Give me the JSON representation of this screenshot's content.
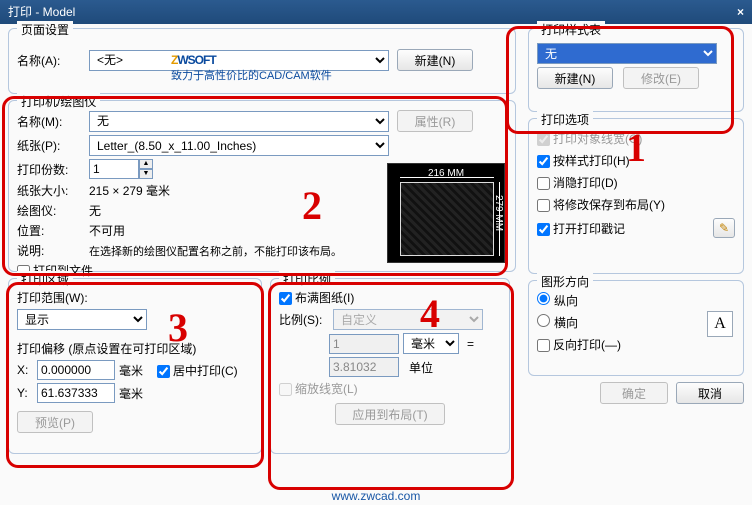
{
  "title": "打印 - Model",
  "page_setup": {
    "legend": "页面设置",
    "name_label": "名称(A):",
    "name_value": "<无>",
    "new_btn": "新建(N)"
  },
  "logo": {
    "tagline": "致力于高性价比的CAD/CAM软件"
  },
  "printer": {
    "legend": "打印机/绘图仪",
    "name_label": "名称(M):",
    "name_value": "无",
    "props_btn": "属性(R)",
    "paper_label": "纸张(P):",
    "paper_value": "Letter_(8.50_x_11.00_Inches)",
    "copies_label": "打印份数:",
    "copies_value": "1",
    "papersize_label": "纸张大小:",
    "papersize_value": "215 × 279  毫米",
    "plotter_label": "绘图仪:",
    "plotter_value": "无",
    "location_label": "位置:",
    "location_value": "不可用",
    "desc_label": "说明:",
    "desc_value": "在选择新的绘图仪配置名称之前，不能打印该布局。",
    "to_file": "打印到文件",
    "preview_top": "216 MM",
    "preview_right": "279 MM"
  },
  "area": {
    "legend": "打印区域",
    "range_label": "打印范围(W):",
    "range_value": "显示",
    "offset_legend": "打印偏移 (原点设置在可打印区域)",
    "x_label": "X:",
    "x_value": "0.000000",
    "y_label": "Y:",
    "y_value": "61.637333",
    "unit": "毫米",
    "center": "居中打印(C)",
    "preview_btn": "预览(P)"
  },
  "scale": {
    "legend": "打印比例",
    "fit": "布满图纸(I)",
    "ratio_label": "比例(S):",
    "ratio_value": "自定义",
    "num": "1",
    "unit_sel": "毫米",
    "eq": "=",
    "den": "3.81032",
    "den_unit": "单位",
    "scale_lw": "缩放线宽(L)",
    "apply_btn": "应用到布局(T)"
  },
  "styletable": {
    "legend": "打印样式表",
    "value": "无",
    "new_btn": "新建(N)",
    "edit_btn": "修改(E)"
  },
  "options": {
    "legend": "打印选项",
    "obj_lw": "打印对象线宽(O)",
    "by_style": "按样式打印(H)",
    "hide": "消隐打印(D)",
    "save_layout": "将修改保存到布局(Y)",
    "open_stamp": "打开打印戳记"
  },
  "orient": {
    "legend": "图形方向",
    "portrait": "纵向",
    "landscape": "横向",
    "reverse": "反向打印(—)"
  },
  "buttons": {
    "ok": "确定",
    "cancel": "取消"
  },
  "footer_url": "www.zwcad.com",
  "annotations": {
    "n1": "1",
    "n2": "2",
    "n3": "3",
    "n4": "4"
  }
}
